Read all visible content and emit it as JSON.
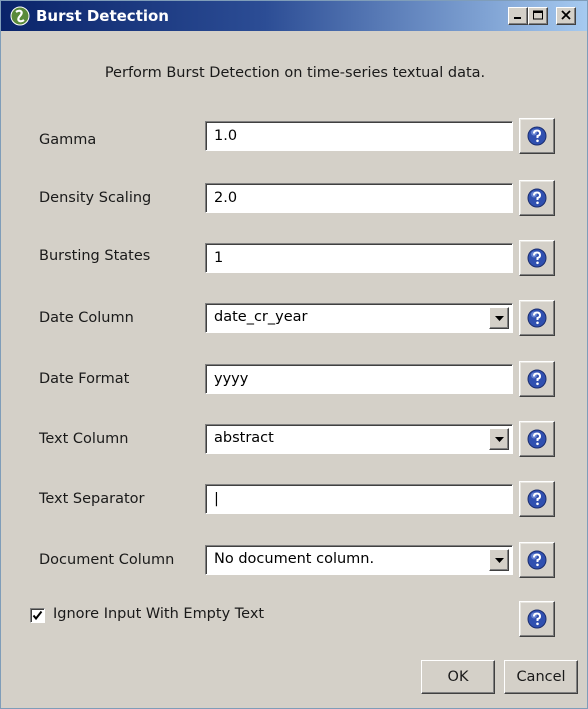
{
  "window": {
    "title": "Burst Detection",
    "title_buttons": [
      "minimize-icon",
      "maximize-icon",
      "close-icon"
    ],
    "colors": {
      "title_start": "#0a246a",
      "title_end": "#a6caf0",
      "face": "#d4d0c8"
    }
  },
  "description": "Perform Burst Detection on time-series textual data.",
  "fields": {
    "gamma": {
      "label": "Gamma",
      "value": "1.0"
    },
    "density_scaling": {
      "label": "Density Scaling",
      "value": "2.0"
    },
    "bursting_states": {
      "label": "Bursting States",
      "value": "1"
    },
    "date_column": {
      "label": "Date Column",
      "value": "date_cr_year"
    },
    "date_format": {
      "label": "Date Format",
      "value": "yyyy"
    },
    "text_column": {
      "label": "Text Column",
      "value": "abstract"
    },
    "text_separator": {
      "label": "Text Separator",
      "value": "|"
    },
    "document_column": {
      "label": "Document Column",
      "value": "No document column."
    }
  },
  "ignore_empty": {
    "label": "Ignore Input With Empty Text",
    "checked": true
  },
  "buttons": {
    "ok": "OK",
    "cancel": "Cancel"
  },
  "help_icon": "question-mark-icon"
}
